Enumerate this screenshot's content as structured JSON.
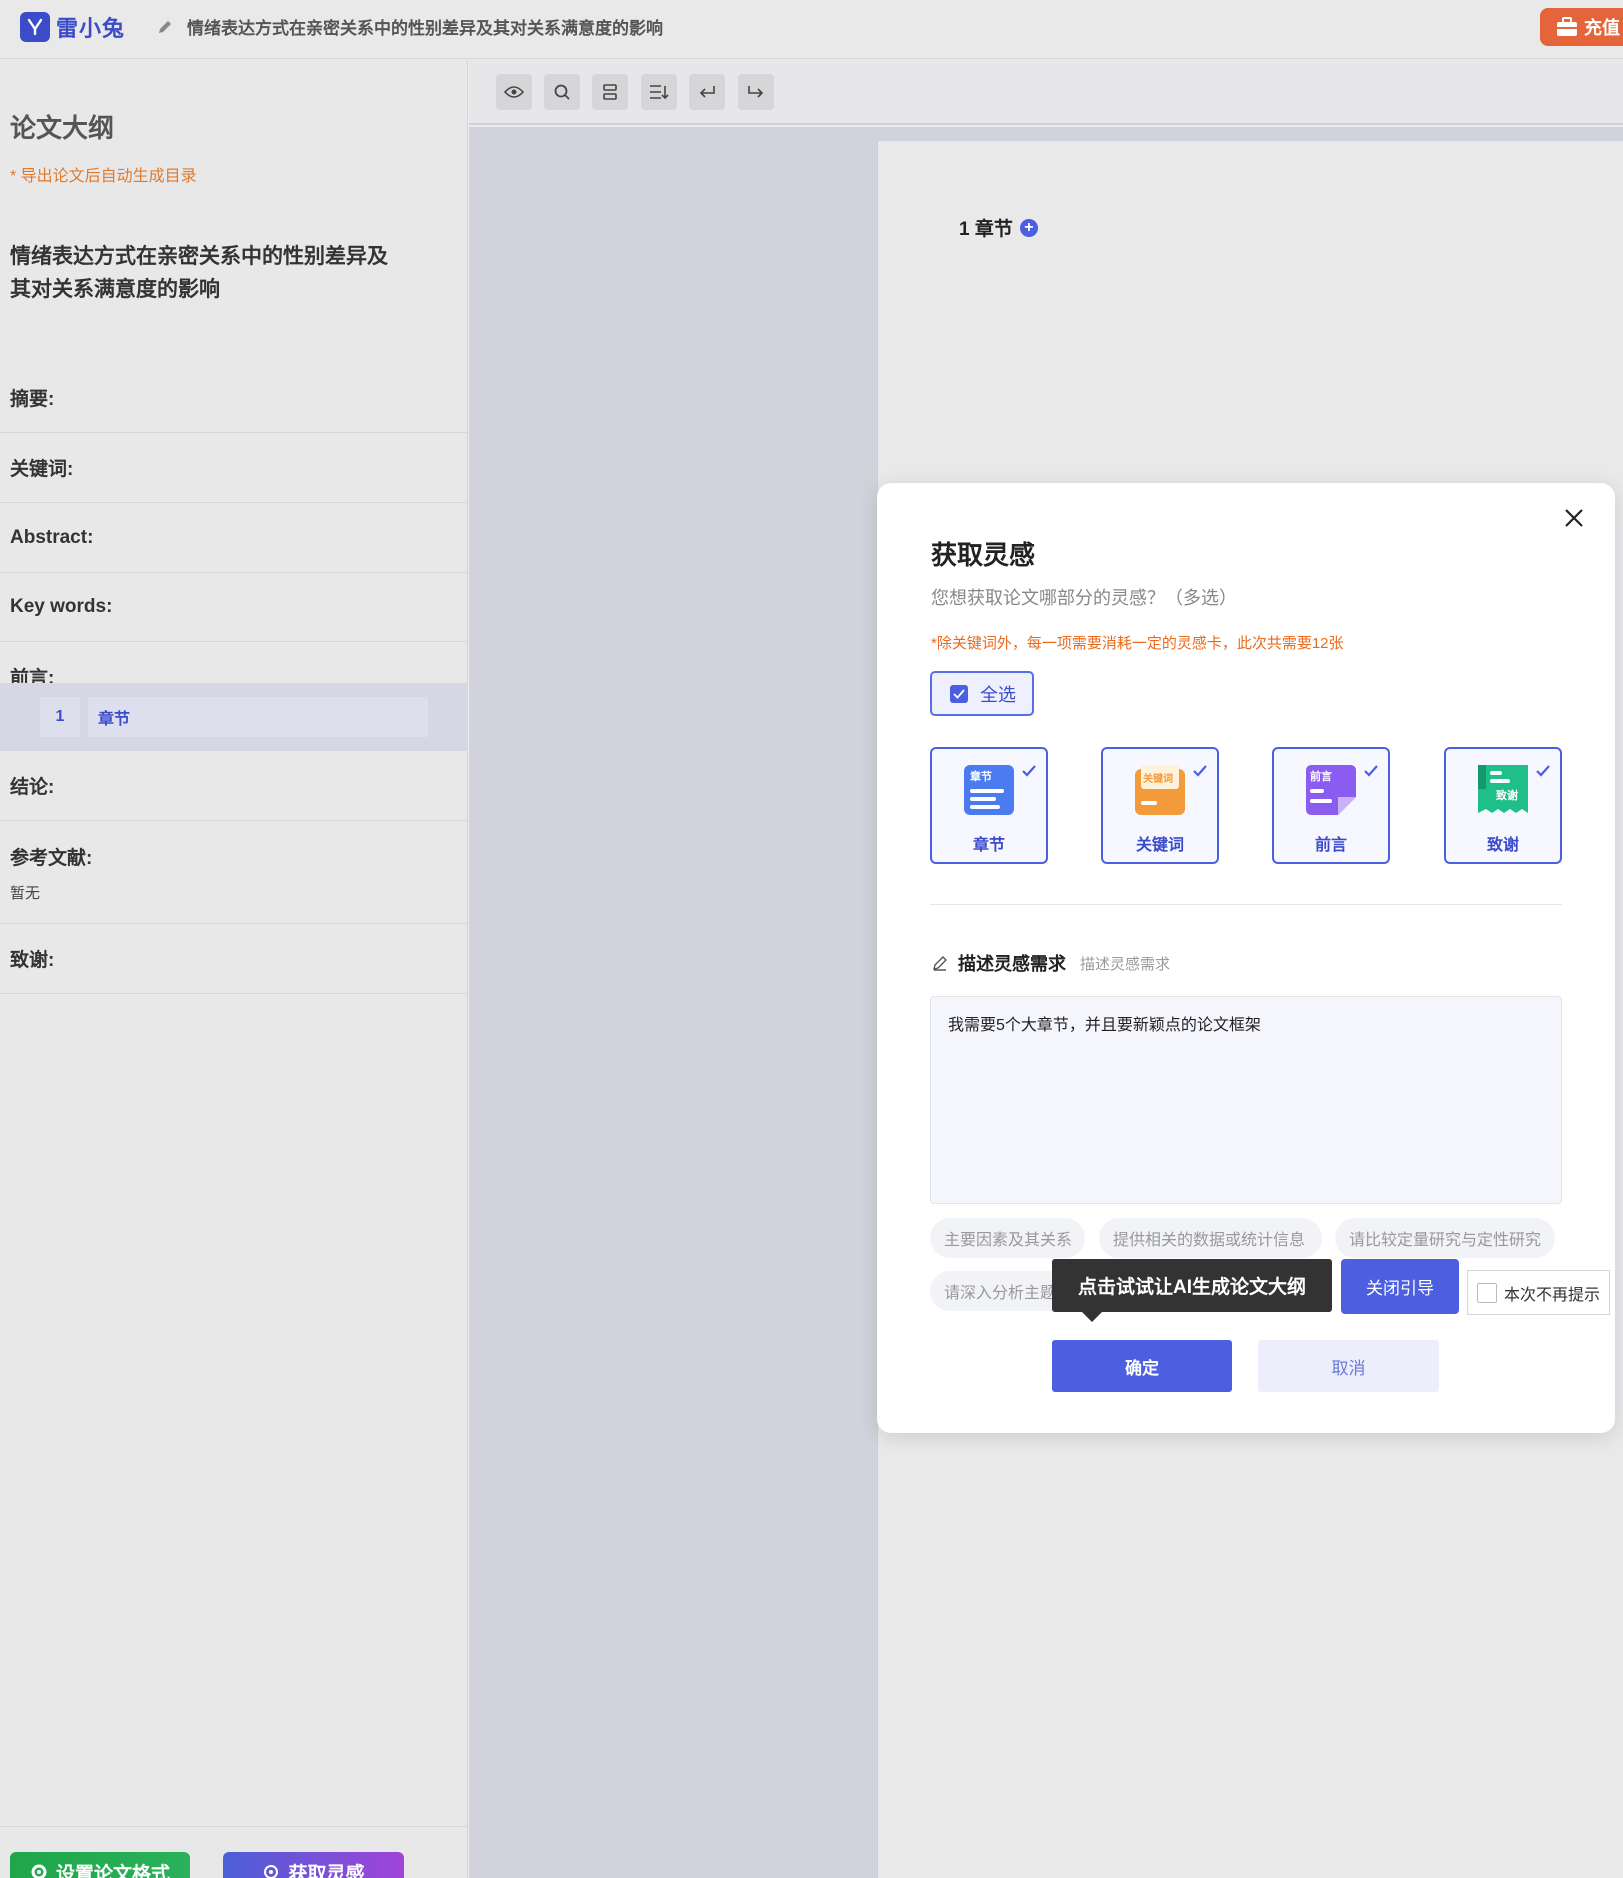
{
  "app": {
    "name": "雷小兔",
    "doc_title": "情绪表达方式在亲密关系中的性别差异及其对关系满意度的影响",
    "recharge_label": "充值"
  },
  "sidebar": {
    "heading": "论文大纲",
    "note": "* 导出论文后自动生成目录",
    "title": "情绪表达方式在亲密关系中的性别差异及其对关系满意度的影响",
    "sections": {
      "abstract_cn": "摘要:",
      "keywords_cn": "关键词:",
      "abstract_en": "Abstract:",
      "keywords_en": "Key words:",
      "preface": "前言:",
      "conclusion": "结论:",
      "references": "参考文献:",
      "references_value": "暂无",
      "acknowledgement": "致谢:"
    },
    "chapter": {
      "number": "1",
      "label": "章节"
    },
    "buttons": {
      "format": "设置论文格式",
      "inspiration": "获取灵感"
    }
  },
  "toolbar": {
    "icons": [
      "eye-icon",
      "search-icon",
      "layout-icon",
      "list-icon",
      "undo-icon",
      "redo-icon"
    ]
  },
  "paper": {
    "chapter_heading": "1 章节"
  },
  "modal": {
    "title": "获取灵感",
    "subtitle": "您想获取论文哪部分的灵感？（多选）",
    "warning": "*除关键词外，每一项需要消耗一定的灵感卡，此次共需要12张",
    "select_all": "全选",
    "cards": [
      {
        "label": "章节",
        "icon_text": "章节",
        "color": "#4a7cf0"
      },
      {
        "label": "关键词",
        "icon_text": "关键词",
        "color": "#f39a3a"
      },
      {
        "label": "前言",
        "icon_text": "前言",
        "color": "#8a5cf0"
      },
      {
        "label": "致谢",
        "icon_text": "致谢",
        "color": "#1fbf8a"
      }
    ],
    "desc_title": "描述灵感需求",
    "desc_hint": "描述灵感需求",
    "desc_value": "我需要5个大章节，并且要新颖点的论文框架",
    "chips": [
      "主要因素及其关系",
      "提供相关的数据或统计信息",
      "请比较定量研究与定性研究",
      "请深入分析主题"
    ],
    "tooltip": "点击试试让AI生成论文大纲",
    "guide_close": "关闭引导",
    "no_remind": "本次不再提示",
    "confirm": "确定",
    "cancel": "取消"
  }
}
